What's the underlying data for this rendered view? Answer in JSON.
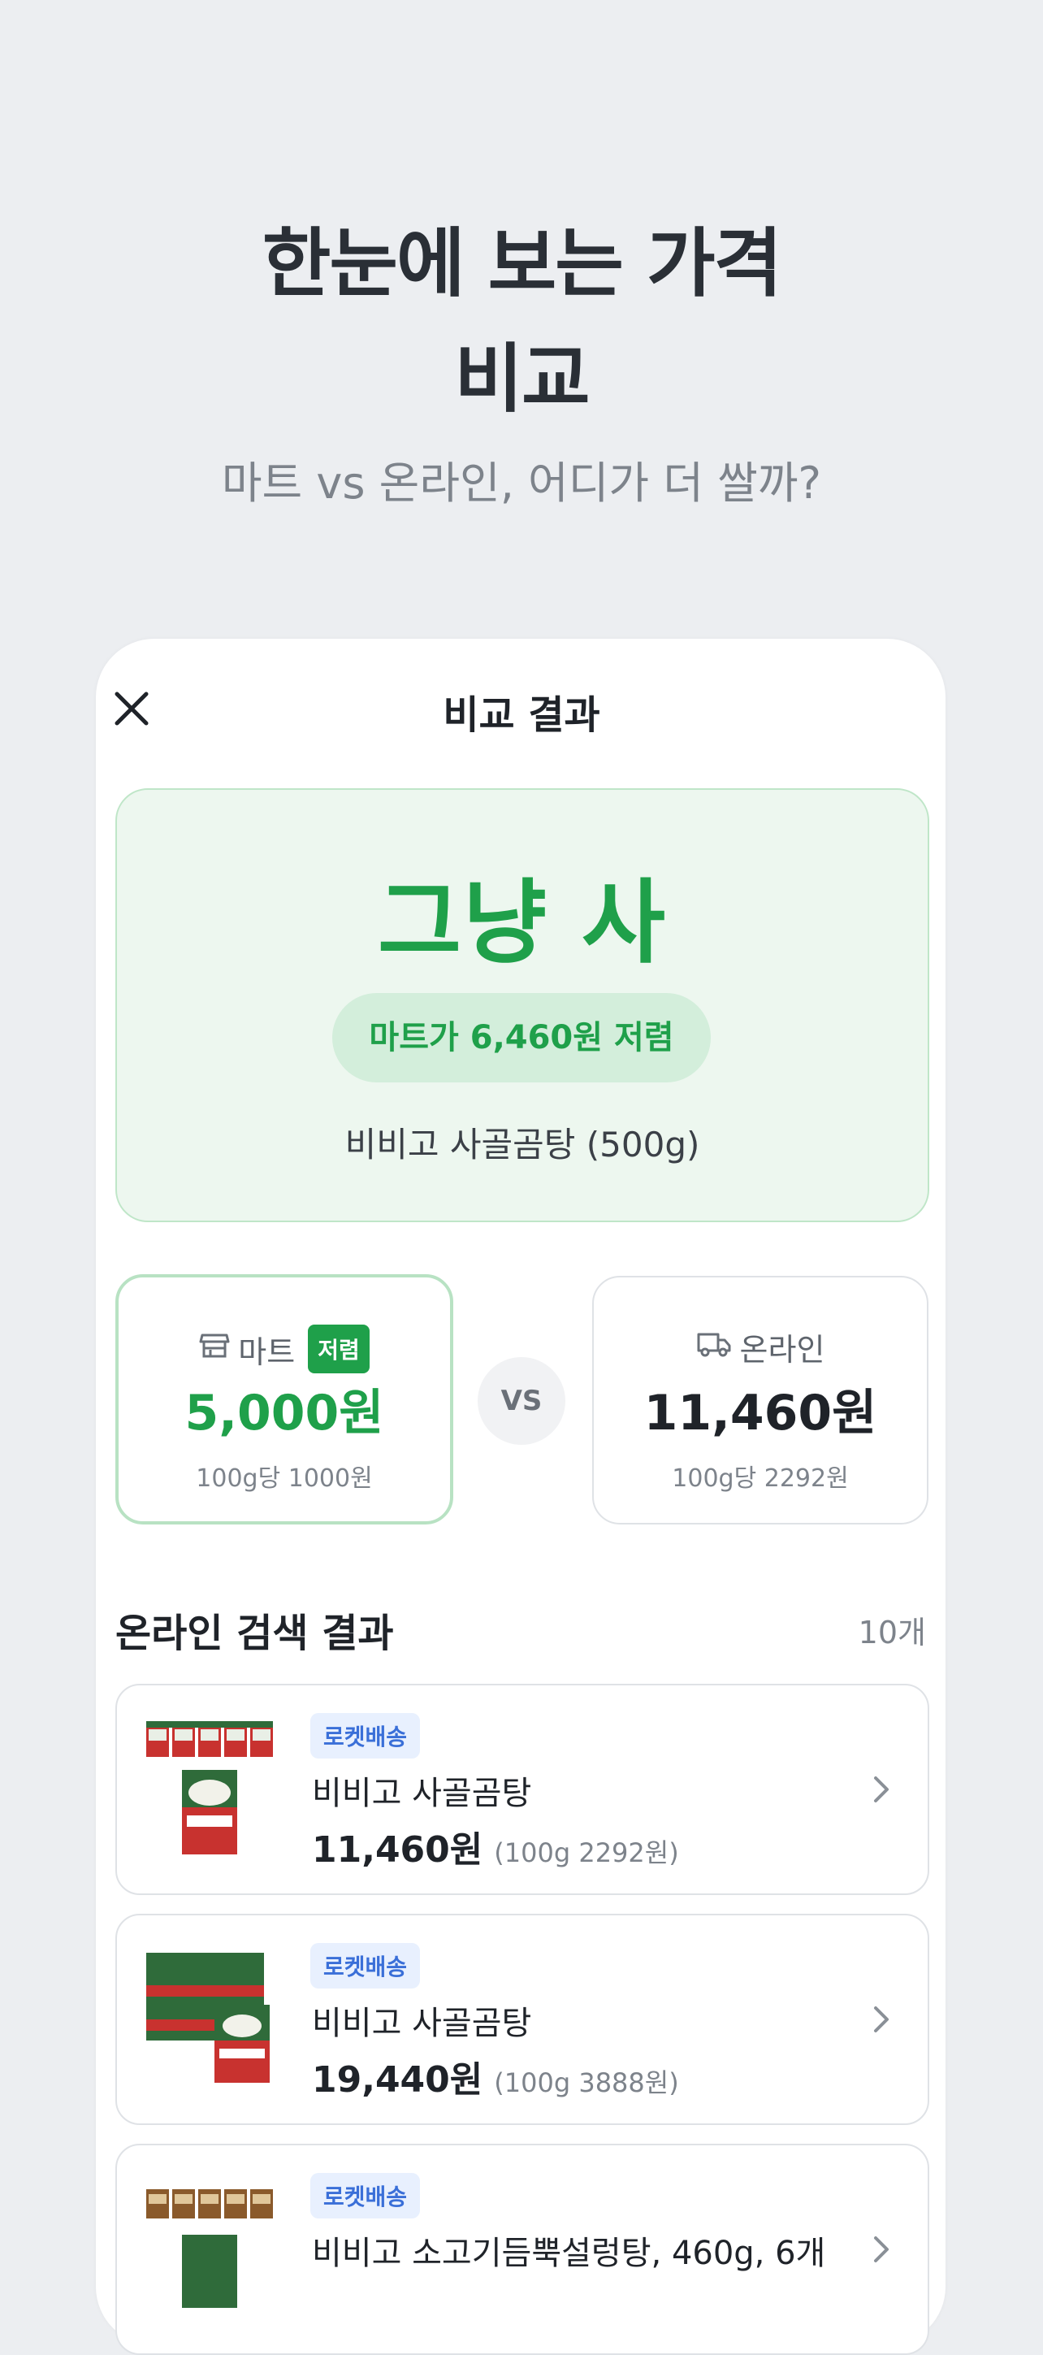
{
  "hero": {
    "title_line1": "한눈에 보는 가격",
    "title_line2": "비교",
    "subtitle": "마트 vs 온라인, 어디가 더 쌀까?"
  },
  "screen": {
    "title": "비교 결과",
    "close_icon": "close-icon"
  },
  "verdict": {
    "text": "그냥 사",
    "savings": "마트가 6,460원 저렴",
    "product": "비비고 사골곰탕 (500g)"
  },
  "compare": {
    "mart": {
      "icon": "store-icon",
      "label": "마트",
      "badge": "저렴",
      "price": "5,000원",
      "unit_price": "100g당 1000원"
    },
    "vs": "VS",
    "online": {
      "icon": "truck-icon",
      "label": "온라인",
      "price": "11,460원",
      "unit_price": "100g당 2292원"
    }
  },
  "results": {
    "title": "온라인 검색 결과",
    "count": "10개",
    "items": [
      {
        "tag": "로켓배송",
        "name": "비비고 사골곰탕",
        "price": "11,460원",
        "unit": "(100g 2292원)"
      },
      {
        "tag": "로켓배송",
        "name": "비비고 사골곰탕",
        "price": "19,440원",
        "unit": "(100g 3888원)"
      },
      {
        "tag": "로켓배송",
        "name": "비비고 소고기듬뿍설렁탕, 460g, 6개",
        "price": "",
        "unit": ""
      }
    ]
  },
  "colors": {
    "accent_green": "#1fa04a",
    "verdict_bg": "#edf7ef",
    "tag_blue": "#3a6fd8",
    "background": "#eceef1"
  }
}
